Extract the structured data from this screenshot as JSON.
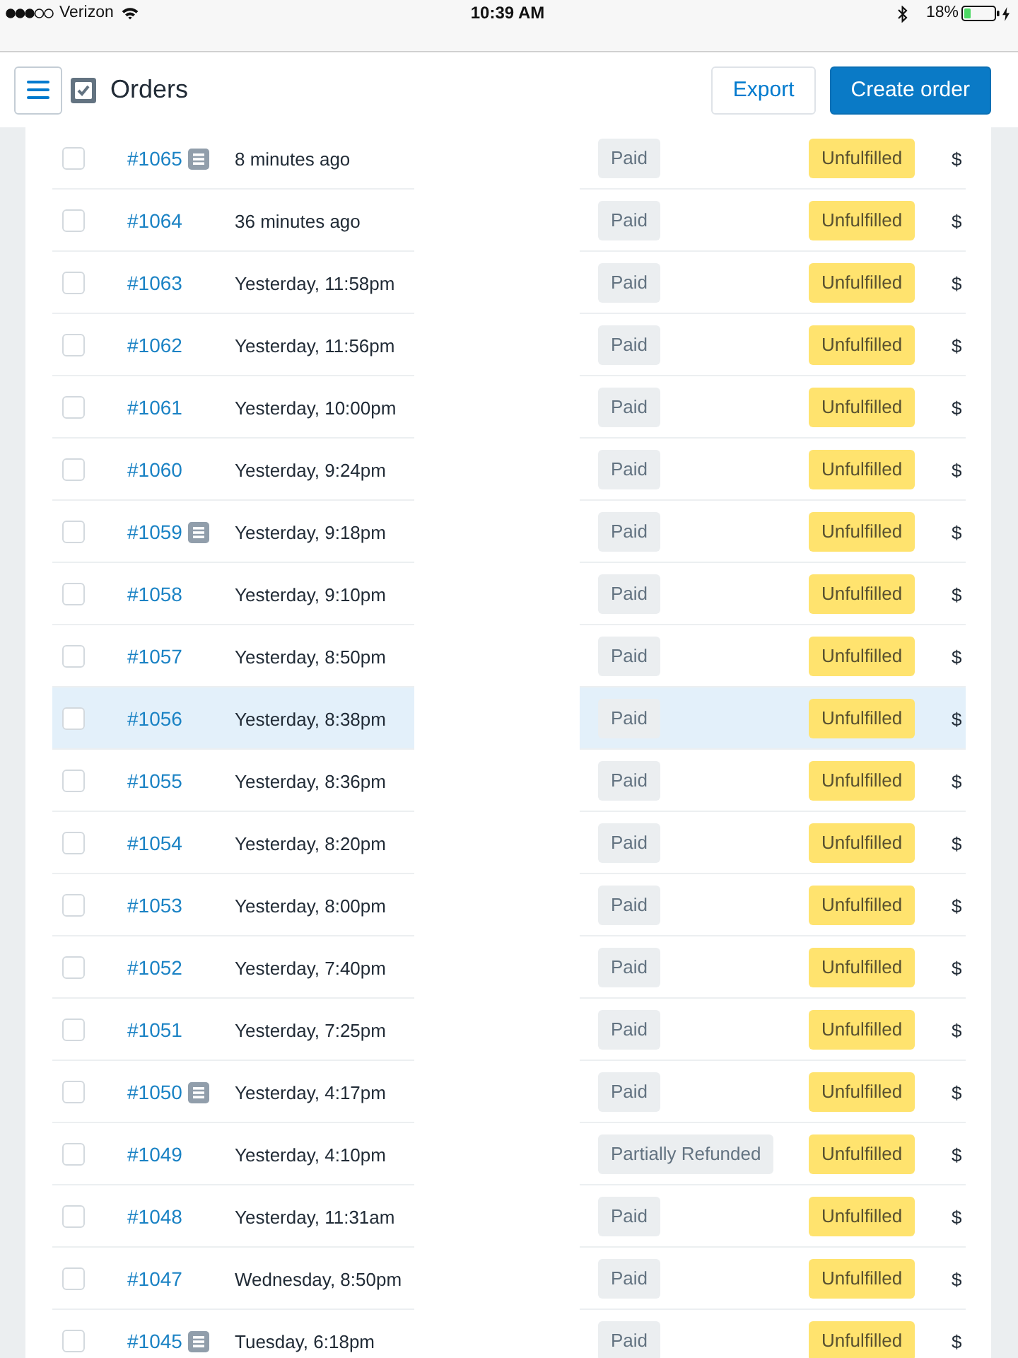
{
  "status_bar": {
    "carrier": "Verizon",
    "time": "10:39 AM",
    "battery": "18%"
  },
  "header": {
    "title": "Orders",
    "buttons": [
      {
        "label": "Export",
        "kind": "secondary"
      },
      {
        "label": "Create order",
        "kind": "primary"
      }
    ]
  },
  "orders": [
    {
      "number": "#1065",
      "note": true,
      "date": "8 minutes ago",
      "checked": false,
      "highlighted": false,
      "payment": "Paid",
      "fulfillment": "Unfulfilled",
      "total": "$"
    },
    {
      "number": "#1064",
      "note": false,
      "date": "36 minutes ago",
      "checked": false,
      "highlighted": false,
      "payment": "Paid",
      "fulfillment": "Unfulfilled",
      "total": "$"
    },
    {
      "number": "#1063",
      "note": false,
      "date": "Yesterday, 11:58pm",
      "checked": false,
      "highlighted": false,
      "payment": "Paid",
      "fulfillment": "Unfulfilled",
      "total": "$"
    },
    {
      "number": "#1062",
      "note": false,
      "date": "Yesterday, 11:56pm",
      "checked": false,
      "highlighted": false,
      "payment": "Paid",
      "fulfillment": "Unfulfilled",
      "total": "$"
    },
    {
      "number": "#1061",
      "note": false,
      "date": "Yesterday, 10:00pm",
      "checked": false,
      "highlighted": false,
      "payment": "Paid",
      "fulfillment": "Unfulfilled",
      "total": "$"
    },
    {
      "number": "#1060",
      "note": false,
      "date": "Yesterday, 9:24pm",
      "checked": false,
      "highlighted": false,
      "payment": "Paid",
      "fulfillment": "Unfulfilled",
      "total": "$"
    },
    {
      "number": "#1059",
      "note": true,
      "date": "Yesterday, 9:18pm",
      "checked": false,
      "highlighted": false,
      "payment": "Paid",
      "fulfillment": "Unfulfilled",
      "total": "$"
    },
    {
      "number": "#1058",
      "note": false,
      "date": "Yesterday, 9:10pm",
      "checked": false,
      "highlighted": false,
      "payment": "Paid",
      "fulfillment": "Unfulfilled",
      "total": "$"
    },
    {
      "number": "#1057",
      "note": false,
      "date": "Yesterday, 8:50pm",
      "checked": false,
      "highlighted": false,
      "payment": "Paid",
      "fulfillment": "Unfulfilled",
      "total": "$"
    },
    {
      "number": "#1056",
      "note": false,
      "date": "Yesterday, 8:38pm",
      "checked": false,
      "highlighted": true,
      "payment": "Paid",
      "fulfillment": "Unfulfilled",
      "total": "$"
    },
    {
      "number": "#1055",
      "note": false,
      "date": "Yesterday, 8:36pm",
      "checked": false,
      "highlighted": false,
      "payment": "Paid",
      "fulfillment": "Unfulfilled",
      "total": "$"
    },
    {
      "number": "#1054",
      "note": false,
      "date": "Yesterday, 8:20pm",
      "checked": false,
      "highlighted": false,
      "payment": "Paid",
      "fulfillment": "Unfulfilled",
      "total": "$"
    },
    {
      "number": "#1053",
      "note": false,
      "date": "Yesterday, 8:00pm",
      "checked": false,
      "highlighted": false,
      "payment": "Paid",
      "fulfillment": "Unfulfilled",
      "total": "$"
    },
    {
      "number": "#1052",
      "note": false,
      "date": "Yesterday, 7:40pm",
      "checked": false,
      "highlighted": false,
      "payment": "Paid",
      "fulfillment": "Unfulfilled",
      "total": "$"
    },
    {
      "number": "#1051",
      "note": false,
      "date": "Yesterday, 7:25pm",
      "checked": false,
      "highlighted": false,
      "payment": "Paid",
      "fulfillment": "Unfulfilled",
      "total": "$"
    },
    {
      "number": "#1050",
      "note": true,
      "date": "Yesterday, 4:17pm",
      "checked": false,
      "highlighted": false,
      "payment": "Paid",
      "fulfillment": "Unfulfilled",
      "total": "$"
    },
    {
      "number": "#1049",
      "note": false,
      "date": "Yesterday, 4:10pm",
      "checked": false,
      "highlighted": false,
      "payment": "Partially Refunded",
      "fulfillment": "Unfulfilled",
      "total": "$"
    },
    {
      "number": "#1048",
      "note": false,
      "date": "Yesterday, 11:31am",
      "checked": false,
      "highlighted": false,
      "payment": "Paid",
      "fulfillment": "Unfulfilled",
      "total": "$"
    },
    {
      "number": "#1047",
      "note": false,
      "date": "Wednesday, 8:50pm",
      "checked": false,
      "highlighted": false,
      "payment": "Paid",
      "fulfillment": "Unfulfilled",
      "total": "$"
    },
    {
      "number": "#1045",
      "note": true,
      "date": "Tuesday, 6:18pm",
      "checked": false,
      "highlighted": false,
      "payment": "Paid",
      "fulfillment": "Unfulfilled",
      "total": "$"
    }
  ]
}
